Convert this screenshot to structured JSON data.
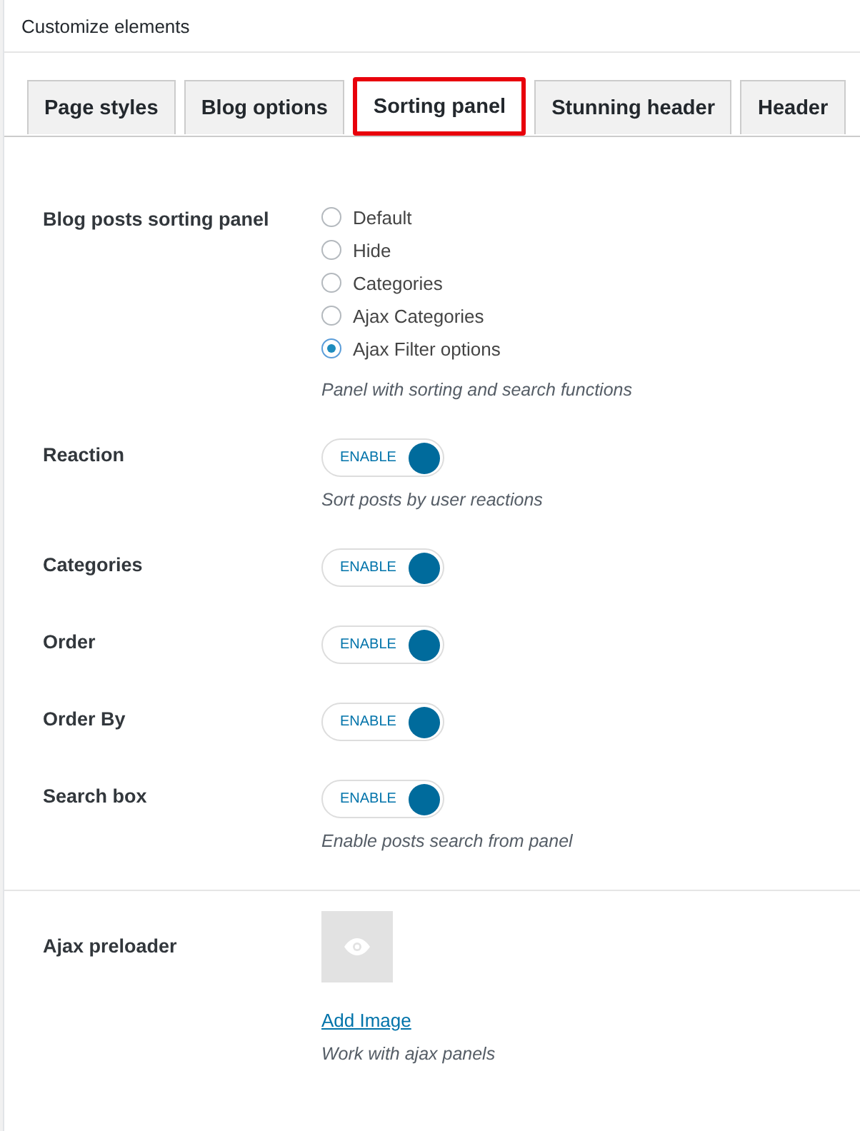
{
  "panel": {
    "title": "Customize elements"
  },
  "tabs": [
    {
      "label": "Page styles",
      "selected": false,
      "highlighted": false
    },
    {
      "label": "Blog options",
      "selected": false,
      "highlighted": false
    },
    {
      "label": "Sorting panel",
      "selected": true,
      "highlighted": true
    },
    {
      "label": "Stunning header",
      "selected": false,
      "highlighted": false
    },
    {
      "label": "Header",
      "selected": false,
      "highlighted": false
    }
  ],
  "sections": [
    {
      "rows": [
        {
          "kind": "radio",
          "label": "Blog posts sorting panel",
          "options": [
            {
              "label": "Default",
              "selected": false
            },
            {
              "label": "Hide",
              "selected": false
            },
            {
              "label": "Categories",
              "selected": false
            },
            {
              "label": "Ajax Categories",
              "selected": false
            },
            {
              "label": "Ajax Filter options",
              "selected": true
            }
          ],
          "description": "Panel with sorting and search functions"
        },
        {
          "kind": "toggle",
          "label": "Reaction",
          "toggle_text": "ENABLE",
          "on": true,
          "description": "Sort posts by user reactions"
        },
        {
          "kind": "toggle",
          "label": "Categories",
          "toggle_text": "ENABLE",
          "on": true
        },
        {
          "kind": "toggle",
          "label": "Order",
          "toggle_text": "ENABLE",
          "on": true
        },
        {
          "kind": "toggle",
          "label": "Order By",
          "toggle_text": "ENABLE",
          "on": true
        },
        {
          "kind": "toggle",
          "label": "Search box",
          "toggle_text": "ENABLE",
          "on": true,
          "description": "Enable posts search from panel"
        }
      ]
    },
    {
      "rows": [
        {
          "kind": "image",
          "label": "Ajax preloader",
          "link": "Add Image",
          "description": "Work with ajax panels"
        }
      ]
    }
  ]
}
